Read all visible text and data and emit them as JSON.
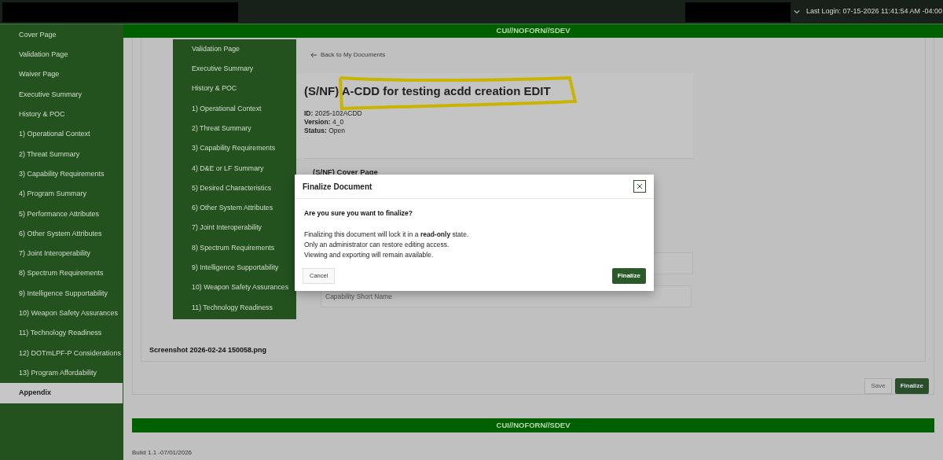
{
  "top_bar": {
    "last_login": "Last Login: 07-15-2026 11:41:54 AM -04:00"
  },
  "sidebar": {
    "items": [
      {
        "label": "Cover Page",
        "selected": false
      },
      {
        "label": "Validation Page",
        "selected": false
      },
      {
        "label": "Waiver Page",
        "selected": false
      },
      {
        "label": "Executive Summary",
        "selected": false
      },
      {
        "label": "History & POC",
        "selected": false
      },
      {
        "label": "1) Operational Context",
        "selected": false
      },
      {
        "label": "2) Threat Summary",
        "selected": false
      },
      {
        "label": "3) Capability Requirements",
        "selected": false
      },
      {
        "label": "4) Program Summary",
        "selected": false
      },
      {
        "label": "5) Performance Attributes",
        "selected": false
      },
      {
        "label": "6) Other System Attributes",
        "selected": false
      },
      {
        "label": "7) Joint Interoperability",
        "selected": false
      },
      {
        "label": "8) Spectrum Requirements",
        "selected": false
      },
      {
        "label": "9) Intelligence Supportability",
        "selected": false
      },
      {
        "label": "10) Weapon Safety Assurances",
        "selected": false
      },
      {
        "label": "11) Technology Readiness",
        "selected": false
      },
      {
        "label": "12) DOTmLPF-P Considerations",
        "selected": false
      },
      {
        "label": "13) Program Affordability",
        "selected": false
      },
      {
        "label": "Appendix",
        "selected": true
      }
    ]
  },
  "top_banner": "CUI//NOFORN//SDEV",
  "document_nav": {
    "items": [
      "Validation Page",
      "Executive Summary",
      "History & POC",
      "1) Operational Context",
      "2) Threat Summary",
      "3) Capability Requirements",
      "4) D&E or LF Summary",
      "5) Desired Characteristics",
      "6) Other System Attributes",
      "7) Joint Interoperability",
      "8) Spectrum Requirements",
      "9) Intelligence Supportability",
      "10) Weapon Safety Assurances",
      "11) Technology Readiness"
    ]
  },
  "back_link": "Back to My Documents",
  "document": {
    "title": "(S/NF) A-CDD for testing acdd creation EDIT",
    "meta": [
      {
        "label": "ID:",
        "value": "2025-102ACDD"
      },
      {
        "label": "Version:",
        "value": "4_0"
      },
      {
        "label": "Status:",
        "value": "Open"
      }
    ]
  },
  "section": {
    "title": "(S/NF) Cover Page",
    "fields": [
      {
        "placeholder": "Capability Short Name"
      }
    ]
  },
  "attachment": "Screenshot 2026-02-24 150058.png",
  "actions": [
    "Save",
    "Finalize"
  ],
  "bottom_banner": "CUI//NOFORN//SDEV",
  "build": "Build 1.1 -07/01/2026",
  "dialog": {
    "title": "Finalize Document",
    "question": "Are you sure you want to finalize?",
    "lines": [
      "Finalizing this document will lock it in a **read-only** state.",
      "Only an administrator can restore editing access.",
      "Viewing and exporting will remain available."
    ],
    "cancel": "Cancel",
    "confirm": "Finalize"
  }
}
